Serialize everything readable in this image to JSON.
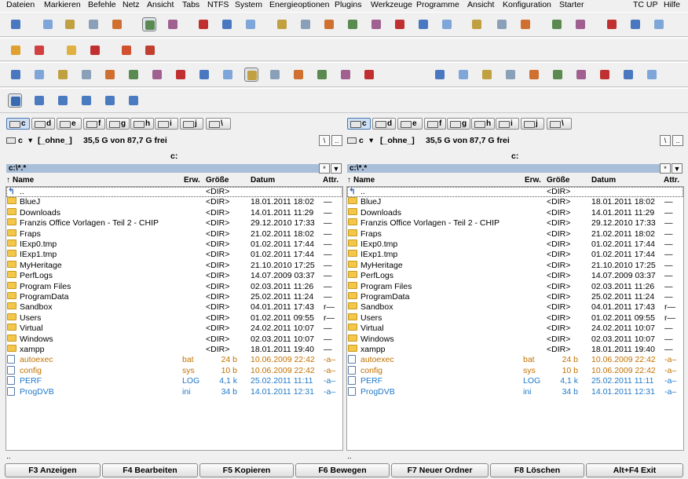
{
  "menu": [
    "Dateien",
    "Markieren",
    "Befehle",
    "Netz",
    "Ansicht",
    "Tabs",
    "NTFS",
    "System",
    "Energieoptionen",
    "Plugins",
    "Werkzeuge",
    "Programme",
    "Ansicht",
    "Konfiguration",
    "Starter"
  ],
  "menu_right": [
    "TC UP",
    "Hilfe"
  ],
  "drives": [
    "c",
    "d",
    "e",
    "f",
    "g",
    "h",
    "i",
    "j",
    "\\"
  ],
  "panel_info": {
    "drive": "c",
    "label": "[_ohne_]",
    "free": "35,5 G von 87,7 G frei"
  },
  "current_dir_label": "c:",
  "path": "c:\\*.*",
  "path_btn_star": "*",
  "path_btn_down": "▼",
  "btn_root": "\\",
  "btn_up": "..",
  "columns": {
    "name": "Name",
    "ext": "Erw.",
    "size": "Größe",
    "date": "Datum",
    "attr": "Attr."
  },
  "rows": [
    {
      "name": "..",
      "ext": "",
      "size": "<DIR>",
      "date": "",
      "attr": "",
      "kind": "up"
    },
    {
      "name": "BlueJ",
      "ext": "",
      "size": "<DIR>",
      "date": "18.01.2011 18:02",
      "attr": "—",
      "kind": "dir"
    },
    {
      "name": "Downloads",
      "ext": "",
      "size": "<DIR>",
      "date": "14.01.2011 11:29",
      "attr": "—",
      "kind": "dir"
    },
    {
      "name": "Franzis Office Vorlagen - Teil 2 - CHIP",
      "ext": "",
      "size": "<DIR>",
      "date": "29.12.2010 17:33",
      "attr": "—",
      "kind": "dir"
    },
    {
      "name": "Fraps",
      "ext": "",
      "size": "<DIR>",
      "date": "21.02.2011 18:02",
      "attr": "—",
      "kind": "dir"
    },
    {
      "name": "IExp0.tmp",
      "ext": "",
      "size": "<DIR>",
      "date": "01.02.2011 17:44",
      "attr": "—",
      "kind": "dir"
    },
    {
      "name": "IExp1.tmp",
      "ext": "",
      "size": "<DIR>",
      "date": "01.02.2011 17:44",
      "attr": "—",
      "kind": "dir"
    },
    {
      "name": "MyHeritage",
      "ext": "",
      "size": "<DIR>",
      "date": "21.10.2010 17:25",
      "attr": "—",
      "kind": "dir"
    },
    {
      "name": "PerfLogs",
      "ext": "",
      "size": "<DIR>",
      "date": "14.07.2009 03:37",
      "attr": "—",
      "kind": "dir"
    },
    {
      "name": "Program Files",
      "ext": "",
      "size": "<DIR>",
      "date": "02.03.2011 11:26",
      "attr": "—",
      "kind": "dir"
    },
    {
      "name": "ProgramData",
      "ext": "",
      "size": "<DIR>",
      "date": "25.02.2011 11:24",
      "attr": "—",
      "kind": "dir"
    },
    {
      "name": "Sandbox",
      "ext": "",
      "size": "<DIR>",
      "date": "04.01.2011 17:43",
      "attr": "r—",
      "kind": "dir"
    },
    {
      "name": "Users",
      "ext": "",
      "size": "<DIR>",
      "date": "01.02.2011 09:55",
      "attr": "r—",
      "kind": "dir"
    },
    {
      "name": "Virtual",
      "ext": "",
      "size": "<DIR>",
      "date": "24.02.2011 10:07",
      "attr": "—",
      "kind": "dir"
    },
    {
      "name": "Windows",
      "ext": "",
      "size": "<DIR>",
      "date": "02.03.2011 10:07",
      "attr": "—",
      "kind": "dir"
    },
    {
      "name": "xampp",
      "ext": "",
      "size": "<DIR>",
      "date": "18.01.2011 19:40",
      "attr": "—",
      "kind": "dir"
    },
    {
      "name": "autoexec",
      "ext": "bat",
      "size": "24 b",
      "date": "10.06.2009 22:42",
      "attr": "-a–",
      "kind": "sys"
    },
    {
      "name": "config",
      "ext": "sys",
      "size": "10 b",
      "date": "10.06.2009 22:42",
      "attr": "-a–",
      "kind": "sys"
    },
    {
      "name": "PERF",
      "ext": "LOG",
      "size": "4,1 k",
      "date": "25.02.2011 11:11",
      "attr": "-a–",
      "kind": "log"
    },
    {
      "name": "ProgDVB",
      "ext": "ini",
      "size": "34 b",
      "date": "14.01.2011 12:31",
      "attr": "-a–",
      "kind": "log"
    }
  ],
  "status": "..",
  "fkeys": [
    "F3 Anzeigen",
    "F4 Bearbeiten",
    "F5 Kopieren",
    "F6 Bewegen",
    "F7 Neuer Ordner",
    "F8 Löschen",
    "Alt+F4 Exit"
  ],
  "colors": {
    "path_bar": "#a9bed8",
    "dir": "#000000",
    "sys_file": "#c07000",
    "log_file": "#1e78c8"
  }
}
